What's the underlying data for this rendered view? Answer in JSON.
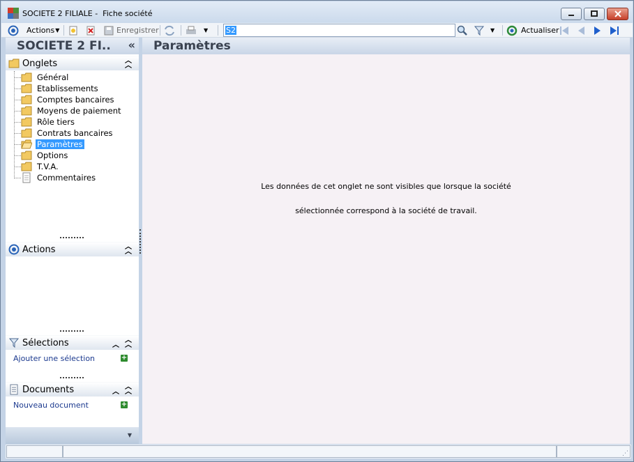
{
  "window": {
    "title": "SOCIETE 2 FILIALE -  Fiche société",
    "controls": [
      "minimize",
      "maximize",
      "close"
    ]
  },
  "toolbar": {
    "actions_label": "Actions",
    "save_label": "Enregistrer",
    "search_value": "S2",
    "refresh_label": "Actualiser"
  },
  "left": {
    "title": "SOCIETE 2 FI..",
    "collapse_glyph": "«",
    "onglets": {
      "label": "Onglets",
      "items": [
        {
          "label": "Général",
          "icon": "folder-icon"
        },
        {
          "label": "Etablissements",
          "icon": "folder-icon"
        },
        {
          "label": "Comptes bancaires",
          "icon": "folder-icon"
        },
        {
          "label": "Moyens de paiement",
          "icon": "folder-icon"
        },
        {
          "label": "Rôle tiers",
          "icon": "folder-icon"
        },
        {
          "label": "Contrats bancaires",
          "icon": "folder-icon"
        },
        {
          "label": "Paramètres",
          "icon": "folder-open-icon",
          "selected": true
        },
        {
          "label": "Options",
          "icon": "folder-icon"
        },
        {
          "label": "T.V.A.",
          "icon": "folder-icon"
        },
        {
          "label": "Commentaires",
          "icon": "document-icon"
        }
      ]
    },
    "actions": {
      "label": "Actions"
    },
    "selections": {
      "label": "Sélections",
      "link": "Ajouter une sélection"
    },
    "documents": {
      "label": "Documents",
      "link": "Nouveau document"
    }
  },
  "main": {
    "title": "Paramètres",
    "message_line1": "Les données de cet onglet ne sont visibles que lorsque la société",
    "message_line2": "sélectionnée correspond à la société de travail."
  },
  "colors": {
    "accent": "#3399ff",
    "header_gradient_top": "#e8eef6",
    "header_gradient_bottom": "#c9d6e7",
    "link": "#1c3a8f",
    "main_bg": "#f6f1f5"
  }
}
